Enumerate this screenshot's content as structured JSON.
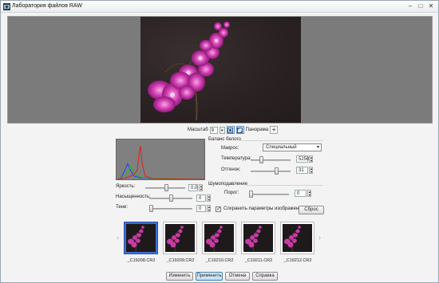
{
  "window": {
    "title": "Лаборатория файлов RAW",
    "minimize_glyph": "–",
    "maximize_glyph": "□",
    "close_glyph": "✕"
  },
  "zoom": {
    "label": "Масштаб",
    "value": "9",
    "dropdown_glyph": "▾",
    "panorama_label": "Панорама",
    "add_glyph": "+"
  },
  "histogram": {
    "colors": {
      "red": "#e02020",
      "green": "#20c020",
      "blue": "#2040ff"
    }
  },
  "adjust": {
    "brightness_label": "Яркость:",
    "brightness_value": "0,0",
    "saturation_label": "Насыщенность:",
    "saturation_value": "0",
    "shadows_label": "Тени:",
    "shadows_value": "0",
    "save_params_label": "Сохранить параметры изображения",
    "save_params_checked": true,
    "check_glyph": "✓",
    "reset_label": "Сброс"
  },
  "white_balance": {
    "group_label": "Баланс белого",
    "preset_label": "Макрос:",
    "preset_value": "Специальный",
    "temperature_label": "Температура:",
    "temperature_value": "5250",
    "tint_label": "Оттенок:",
    "tint_value": "31"
  },
  "noise": {
    "group_label": "Шумоподавление",
    "threshold_label": "Порог:",
    "threshold_value": "0"
  },
  "filmstrip": {
    "left_arrow": "‹",
    "right_arrow": "›",
    "files": [
      {
        "name": "_C19208.CR2",
        "selected": true
      },
      {
        "name": "_C19209.CR2",
        "selected": false
      },
      {
        "name": "_C19210.CR2",
        "selected": false
      },
      {
        "name": "_C19211.CR2",
        "selected": false
      },
      {
        "name": "_C19212.CR2",
        "selected": false
      }
    ]
  },
  "footer": {
    "change_label": "Изменить",
    "apply_label": "Применить",
    "cancel_label": "Отмена",
    "help_label": "Справка"
  }
}
